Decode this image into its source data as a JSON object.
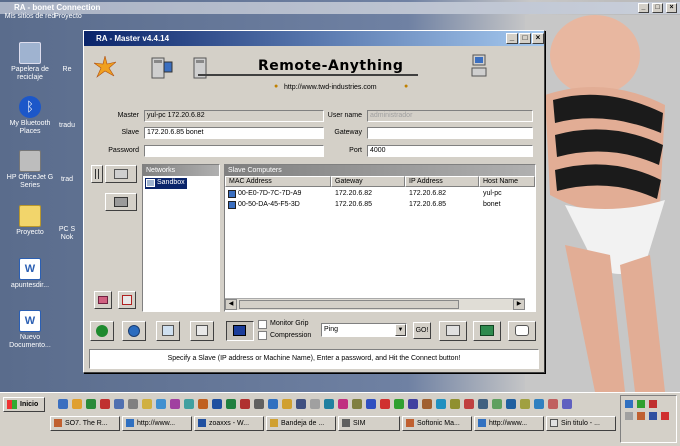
{
  "back_window": {
    "title": "RA - bonet Connection"
  },
  "desktop_icons": [
    {
      "label": "Mis sitios de red"
    },
    {
      "label": "Proyecto"
    },
    {
      "label": "Papelera de reciclaje"
    },
    {
      "label": "Re"
    },
    {
      "label": "My Bluetooth Places"
    },
    {
      "label": "tradu"
    },
    {
      "label": "HP OfficeJet G Series"
    },
    {
      "label": "trad"
    },
    {
      "label": "Proyecto"
    },
    {
      "label": "PC S Nok"
    },
    {
      "label": "apuntesdir..."
    },
    {
      "label": "Nuevo Documento..."
    }
  ],
  "window": {
    "title": "RA - Master v4.4.14",
    "banner_title": "Remote-Anything",
    "banner_url": "http://www.twd-industries.com"
  },
  "form": {
    "master_label": "Master",
    "master_value": "yul-pc 172.20.6.82",
    "username_label": "User name",
    "username_value": "administrador",
    "slave_label": "Slave",
    "slave_value": "172.20.6.85 bonet",
    "gateway_label": "Gateway",
    "gateway_value": "",
    "password_label": "Password",
    "password_value": "",
    "port_label": "Port",
    "port_value": "4000"
  },
  "networks": {
    "header": "Networks",
    "items": [
      "Sandbox"
    ]
  },
  "slaves": {
    "header": "Slave Computers",
    "columns": [
      "MAC Address",
      "Gateway",
      "IP Address",
      "Host Name"
    ],
    "rows": [
      [
        "00-E0-7D-7C-7D-A9",
        "172.20.6.82",
        "172.20.6.82",
        "yul-pc"
      ],
      [
        "00-50-DA-45-F5-3D",
        "172.20.6.85",
        "172.20.6.85",
        "bonet"
      ]
    ]
  },
  "toolbar": {
    "monitor_grip_label": "Monitor Grip",
    "compression_label": "Compression",
    "action_select": "Ping",
    "go_label": "GO!"
  },
  "status_text": "Specify a Slave (IP address or Machine Name), Enter a password, and Hit the Connect button!",
  "taskbar": {
    "start_label": "Inicio",
    "tasks": [
      "SO7. The R...",
      "http://www...",
      "zoaxxs - W...",
      "Bandeja de ...",
      "SIM",
      "Softonic Ma...",
      "http://www...",
      "Sin titulo - ..."
    ]
  },
  "colors": {
    "titlebar_start": "#0a246a",
    "titlebar_end": "#a6caf0",
    "face": "#d4d0c8"
  }
}
